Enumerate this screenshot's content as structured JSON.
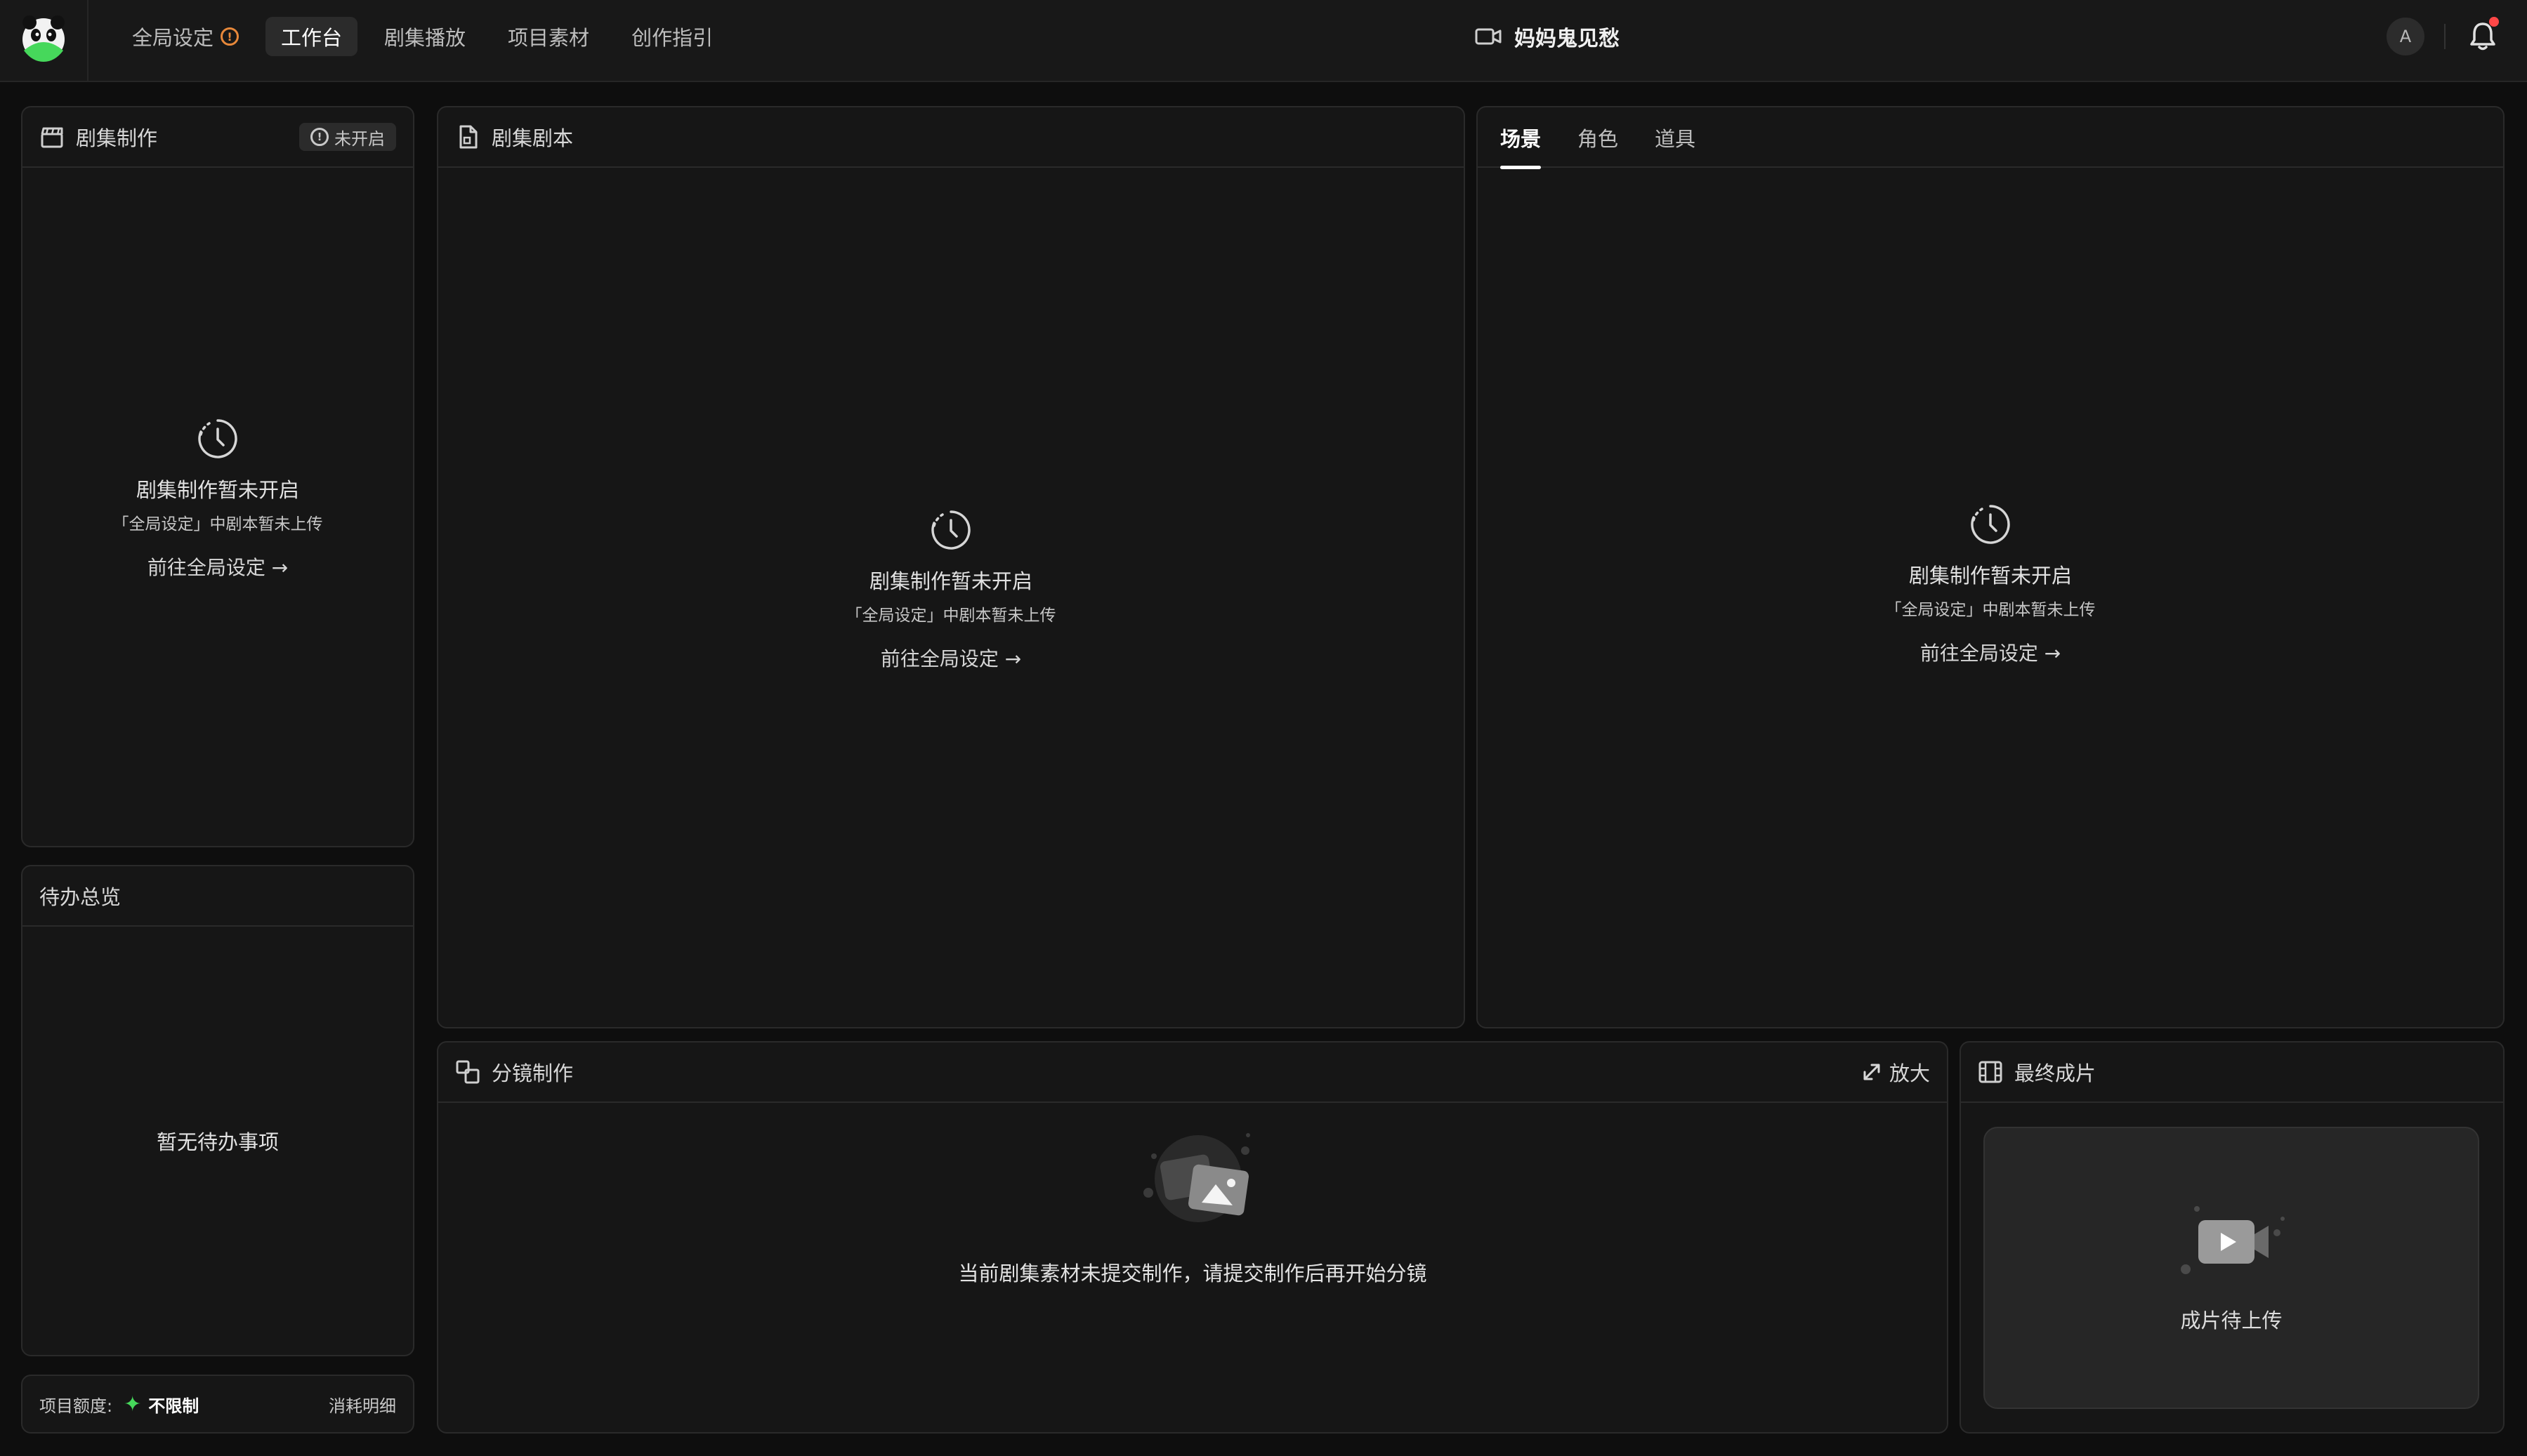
{
  "topbar": {
    "nav": [
      {
        "label": "全局设定",
        "active": false,
        "warning": "!"
      },
      {
        "label": "工作台",
        "active": true
      },
      {
        "label": "剧集播放",
        "active": false
      },
      {
        "label": "项目素材",
        "active": false
      },
      {
        "label": "创作指引",
        "active": false
      }
    ],
    "project_title": "妈妈鬼见愁",
    "avatar_letter": "A"
  },
  "production_panel": {
    "title": "剧集制作",
    "status_icon": "!",
    "status": "未开启",
    "empty_title": "剧集制作暂未开启",
    "empty_desc": "「全局设定」中剧本暂未上传",
    "empty_link": "前往全局设定 →"
  },
  "todo_panel": {
    "title": "待办总览",
    "empty": "暂无待办事项"
  },
  "quota": {
    "label": "项目额度:",
    "value": "不限制",
    "detail_link": "消耗明细"
  },
  "script_panel": {
    "title": "剧集剧本",
    "empty_title": "剧集制作暂未开启",
    "empty_desc": "「全局设定」中剧本暂未上传",
    "empty_link": "前往全局设定 →"
  },
  "assets_panel": {
    "tabs": [
      {
        "label": "场景",
        "active": true
      },
      {
        "label": "角色",
        "active": false
      },
      {
        "label": "道具",
        "active": false
      }
    ],
    "empty_title": "剧集制作暂未开启",
    "empty_desc": "「全局设定」中剧本暂未上传",
    "empty_link": "前往全局设定 →"
  },
  "storyboard_panel": {
    "title": "分镜制作",
    "zoom_label": "放大",
    "empty": "当前剧集素材未提交制作，请提交制作后再开始分镜"
  },
  "final_panel": {
    "title": "最终成片",
    "upload_label": "成片待上传"
  },
  "colors": {
    "background": "#0e0e0e",
    "panel": "#161616",
    "border": "#2a2a2a",
    "warning": "#e7883a",
    "accent_green": "#46d85b",
    "notification": "#ff4747"
  }
}
